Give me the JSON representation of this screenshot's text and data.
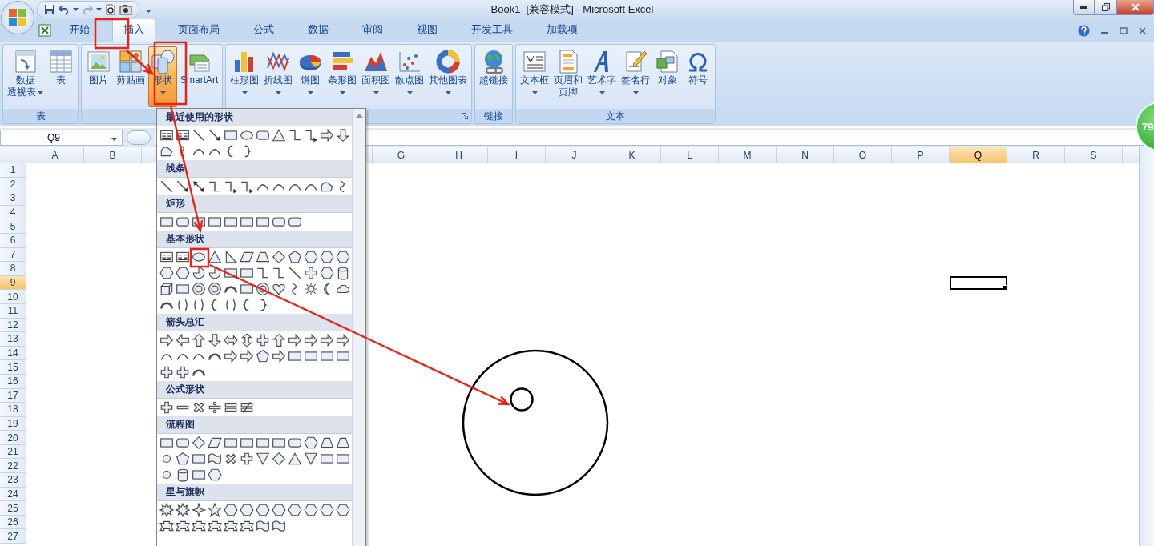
{
  "window": {
    "title": "Book1  [兼容模式] - Microsoft Excel"
  },
  "tabs": [
    {
      "label": "开始",
      "selected": false
    },
    {
      "label": "插入",
      "selected": true
    },
    {
      "label": "页面布局",
      "selected": false
    },
    {
      "label": "公式",
      "selected": false
    },
    {
      "label": "数据",
      "selected": false
    },
    {
      "label": "审阅",
      "selected": false
    },
    {
      "label": "视图",
      "selected": false
    },
    {
      "label": "开发工具",
      "selected": false
    },
    {
      "label": "加载项",
      "selected": false
    }
  ],
  "ribbon_groups": [
    {
      "label": "表",
      "launcher": false,
      "buttons": [
        {
          "lines": [
            "数据",
            "透视表"
          ],
          "dropdown": true,
          "pressed": false
        },
        {
          "lines": [
            "表"
          ],
          "dropdown": false,
          "pressed": false
        }
      ]
    },
    {
      "launcher": false,
      "buttons": [
        {
          "lines": [
            "图片"
          ],
          "dropdown": false,
          "pressed": false
        },
        {
          "lines": [
            "剪贴画"
          ],
          "dropdown": false,
          "pressed": false
        },
        {
          "lines": [
            "形状"
          ],
          "dropdown": true,
          "pressed": true
        },
        {
          "lines": [
            "SmartArt"
          ],
          "dropdown": false,
          "pressed": false
        }
      ]
    },
    {
      "launcher": true,
      "buttons": [
        {
          "lines": [
            "柱形图"
          ],
          "dropdown": true,
          "pressed": false
        },
        {
          "lines": [
            "折线图"
          ],
          "dropdown": true,
          "pressed": false
        },
        {
          "lines": [
            "饼图"
          ],
          "dropdown": true,
          "pressed": false
        },
        {
          "lines": [
            "条形图"
          ],
          "dropdown": true,
          "pressed": false
        },
        {
          "lines": [
            "面积图"
          ],
          "dropdown": true,
          "pressed": false
        },
        {
          "lines": [
            "散点图"
          ],
          "dropdown": true,
          "pressed": false
        },
        {
          "lines": [
            "其他图表"
          ],
          "dropdown": true,
          "pressed": false
        }
      ]
    },
    {
      "label": "链接",
      "launcher": false,
      "buttons": [
        {
          "lines": [
            "超链接"
          ],
          "dropdown": false,
          "pressed": false
        }
      ]
    },
    {
      "label": "文本",
      "launcher": false,
      "buttons": [
        {
          "lines": [
            "文本框"
          ],
          "dropdown": true,
          "pressed": false
        },
        {
          "lines": [
            "页眉和",
            "页脚"
          ],
          "dropdown": false,
          "pressed": false
        },
        {
          "lines": [
            "艺术字"
          ],
          "dropdown": true,
          "pressed": false
        },
        {
          "lines": [
            "签名行"
          ],
          "dropdown": true,
          "pressed": false
        },
        {
          "lines": [
            "对象"
          ],
          "dropdown": false,
          "pressed": false
        },
        {
          "lines": [
            "符号"
          ],
          "dropdown": false,
          "pressed": false
        }
      ]
    }
  ],
  "name_box": "Q9",
  "columns": [
    {
      "label": "A",
      "selected": false
    },
    {
      "label": "B",
      "selected": false
    },
    {},
    {},
    {},
    {},
    {
      "label": "G",
      "selected": false
    },
    {
      "label": "H",
      "selected": false
    },
    {
      "label": "I",
      "selected": false
    },
    {
      "label": "J",
      "selected": false
    },
    {
      "label": "K",
      "selected": false
    },
    {
      "label": "L",
      "selected": false
    },
    {
      "label": "M",
      "selected": false
    },
    {
      "label": "N",
      "selected": false
    },
    {
      "label": "O",
      "selected": false
    },
    {
      "label": "P",
      "selected": false
    },
    {
      "label": "Q",
      "selected": true
    },
    {
      "label": "R",
      "selected": false
    },
    {
      "label": "S",
      "selected": false
    }
  ],
  "rows": [
    {
      "label": "1",
      "selected": false
    },
    {
      "label": "2",
      "selected": false
    },
    {
      "label": "3",
      "selected": false
    },
    {
      "label": "4",
      "selected": false
    },
    {
      "label": "5",
      "selected": false
    },
    {
      "label": "6",
      "selected": false
    },
    {
      "label": "7",
      "selected": false
    },
    {
      "label": "8",
      "selected": false
    },
    {
      "label": "9",
      "selected": true
    },
    {
      "label": "10",
      "selected": false
    },
    {
      "label": "11",
      "selected": false
    },
    {
      "label": "12",
      "selected": false
    },
    {
      "label": "13",
      "selected": false
    },
    {
      "label": "14",
      "selected": false
    },
    {
      "label": "15",
      "selected": false
    },
    {
      "label": "16",
      "selected": false
    },
    {
      "label": "17",
      "selected": false
    },
    {
      "label": "18",
      "selected": false
    },
    {
      "label": "19",
      "selected": false
    },
    {
      "label": "20",
      "selected": false
    },
    {
      "label": "21",
      "selected": false
    },
    {
      "label": "22",
      "selected": false
    },
    {
      "label": "23",
      "selected": false
    },
    {
      "label": "24",
      "selected": false
    },
    {
      "label": "25",
      "selected": false
    },
    {
      "label": "26",
      "selected": false
    },
    {
      "label": "27",
      "selected": false
    }
  ],
  "shapes_menu": {
    "sections": [
      {
        "title": "最近使用的形状"
      },
      {
        "title": "线条"
      },
      {
        "title": "矩形"
      },
      {
        "title": "基本形状"
      },
      {
        "title": "箭头总汇"
      },
      {
        "title": "公式形状"
      },
      {
        "title": "流程图"
      },
      {
        "title": "星与旗帜"
      }
    ]
  },
  "badge": "79"
}
